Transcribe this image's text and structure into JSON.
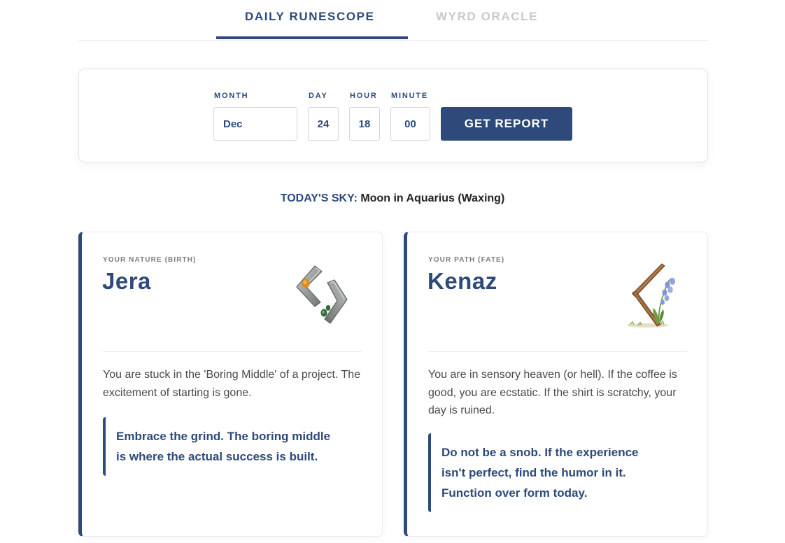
{
  "tabs": {
    "active_label": "DAILY RUNESCOPE",
    "inactive_label": "WYRD ORACLE"
  },
  "form": {
    "month_label": "MONTH",
    "day_label": "DAY",
    "hour_label": "HOUR",
    "minute_label": "MINUTE",
    "month_value": "Dec",
    "day_value": "24",
    "hour_value": "18",
    "minute_value": "00",
    "button_label": "GET REPORT"
  },
  "sky": {
    "label": "TODAY'S SKY:",
    "value": "Moon in Aquarius (Waxing)"
  },
  "cards": [
    {
      "kicker": "YOUR NATURE (BIRTH)",
      "title": "Jera",
      "icon": "jera-rune-stone-icon",
      "description": "You are stuck in the 'Boring Middle' of a project. The excitement of starting is gone.",
      "advice": "Embrace the grind. The boring middle is where the actual success is built."
    },
    {
      "kicker": "YOUR PATH (FATE)",
      "title": "Kenaz",
      "icon": "kenaz-rune-twig-flower-icon",
      "description": "You are in sensory heaven (or hell). If the coffee is good, you are ecstatic. If the shirt is scratchy, your day is ruined.",
      "advice": "Do not be a snob. If the experience isn't perfect, find the humor in it. Function over form today."
    }
  ],
  "colors": {
    "brand": "#2d4a7a",
    "tab_inactive": "#c9c9cd",
    "text": "#4a4a4a"
  }
}
